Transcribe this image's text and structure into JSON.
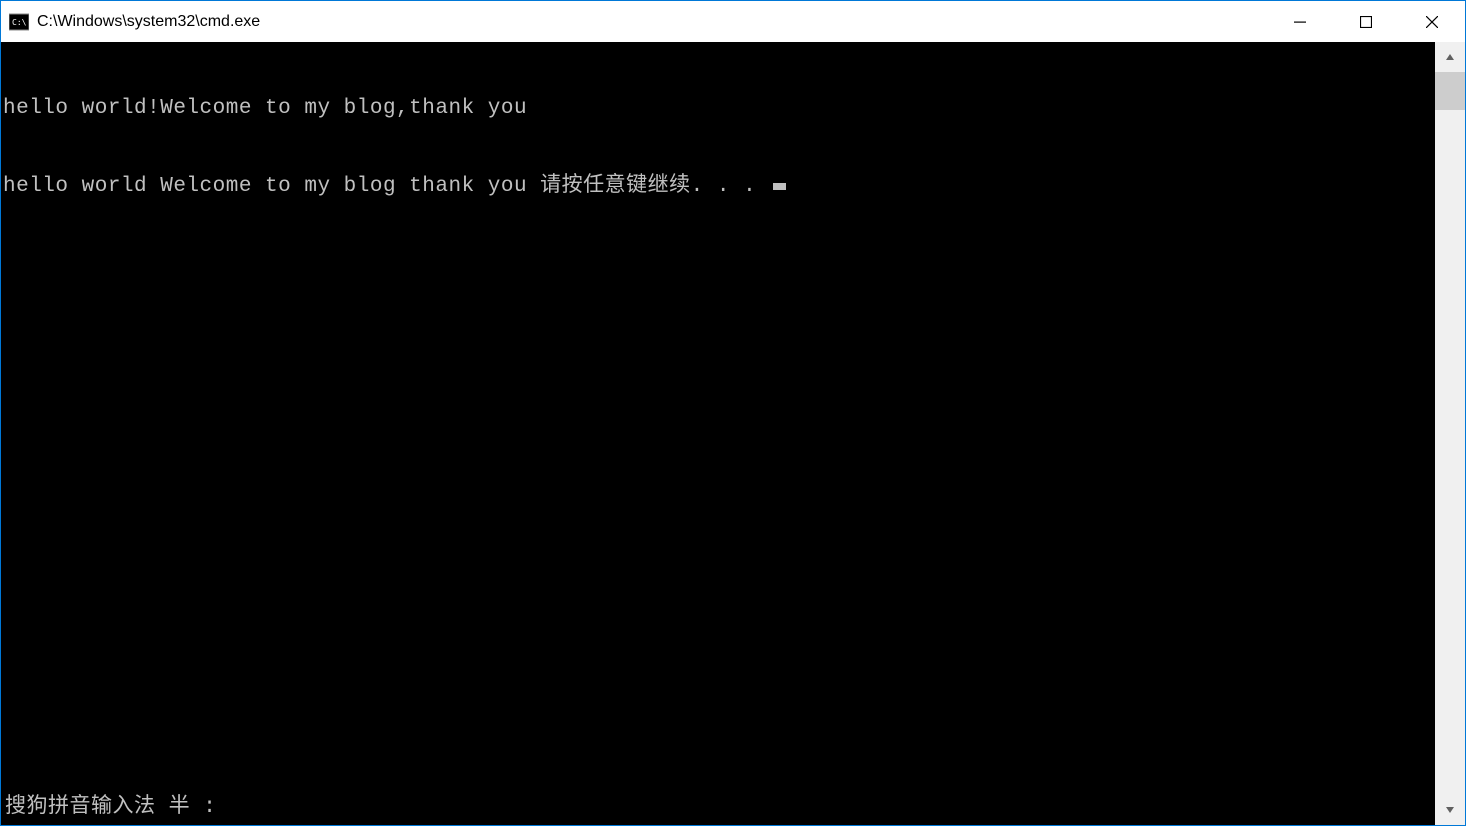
{
  "window": {
    "title": "C:\\Windows\\system32\\cmd.exe"
  },
  "terminal": {
    "line1": "hello world!Welcome to my blog,thank you",
    "line2": "hello world Welcome to my blog thank you 请按任意键继续. . . "
  },
  "ime": {
    "status": "搜狗拼音输入法 半 :"
  }
}
